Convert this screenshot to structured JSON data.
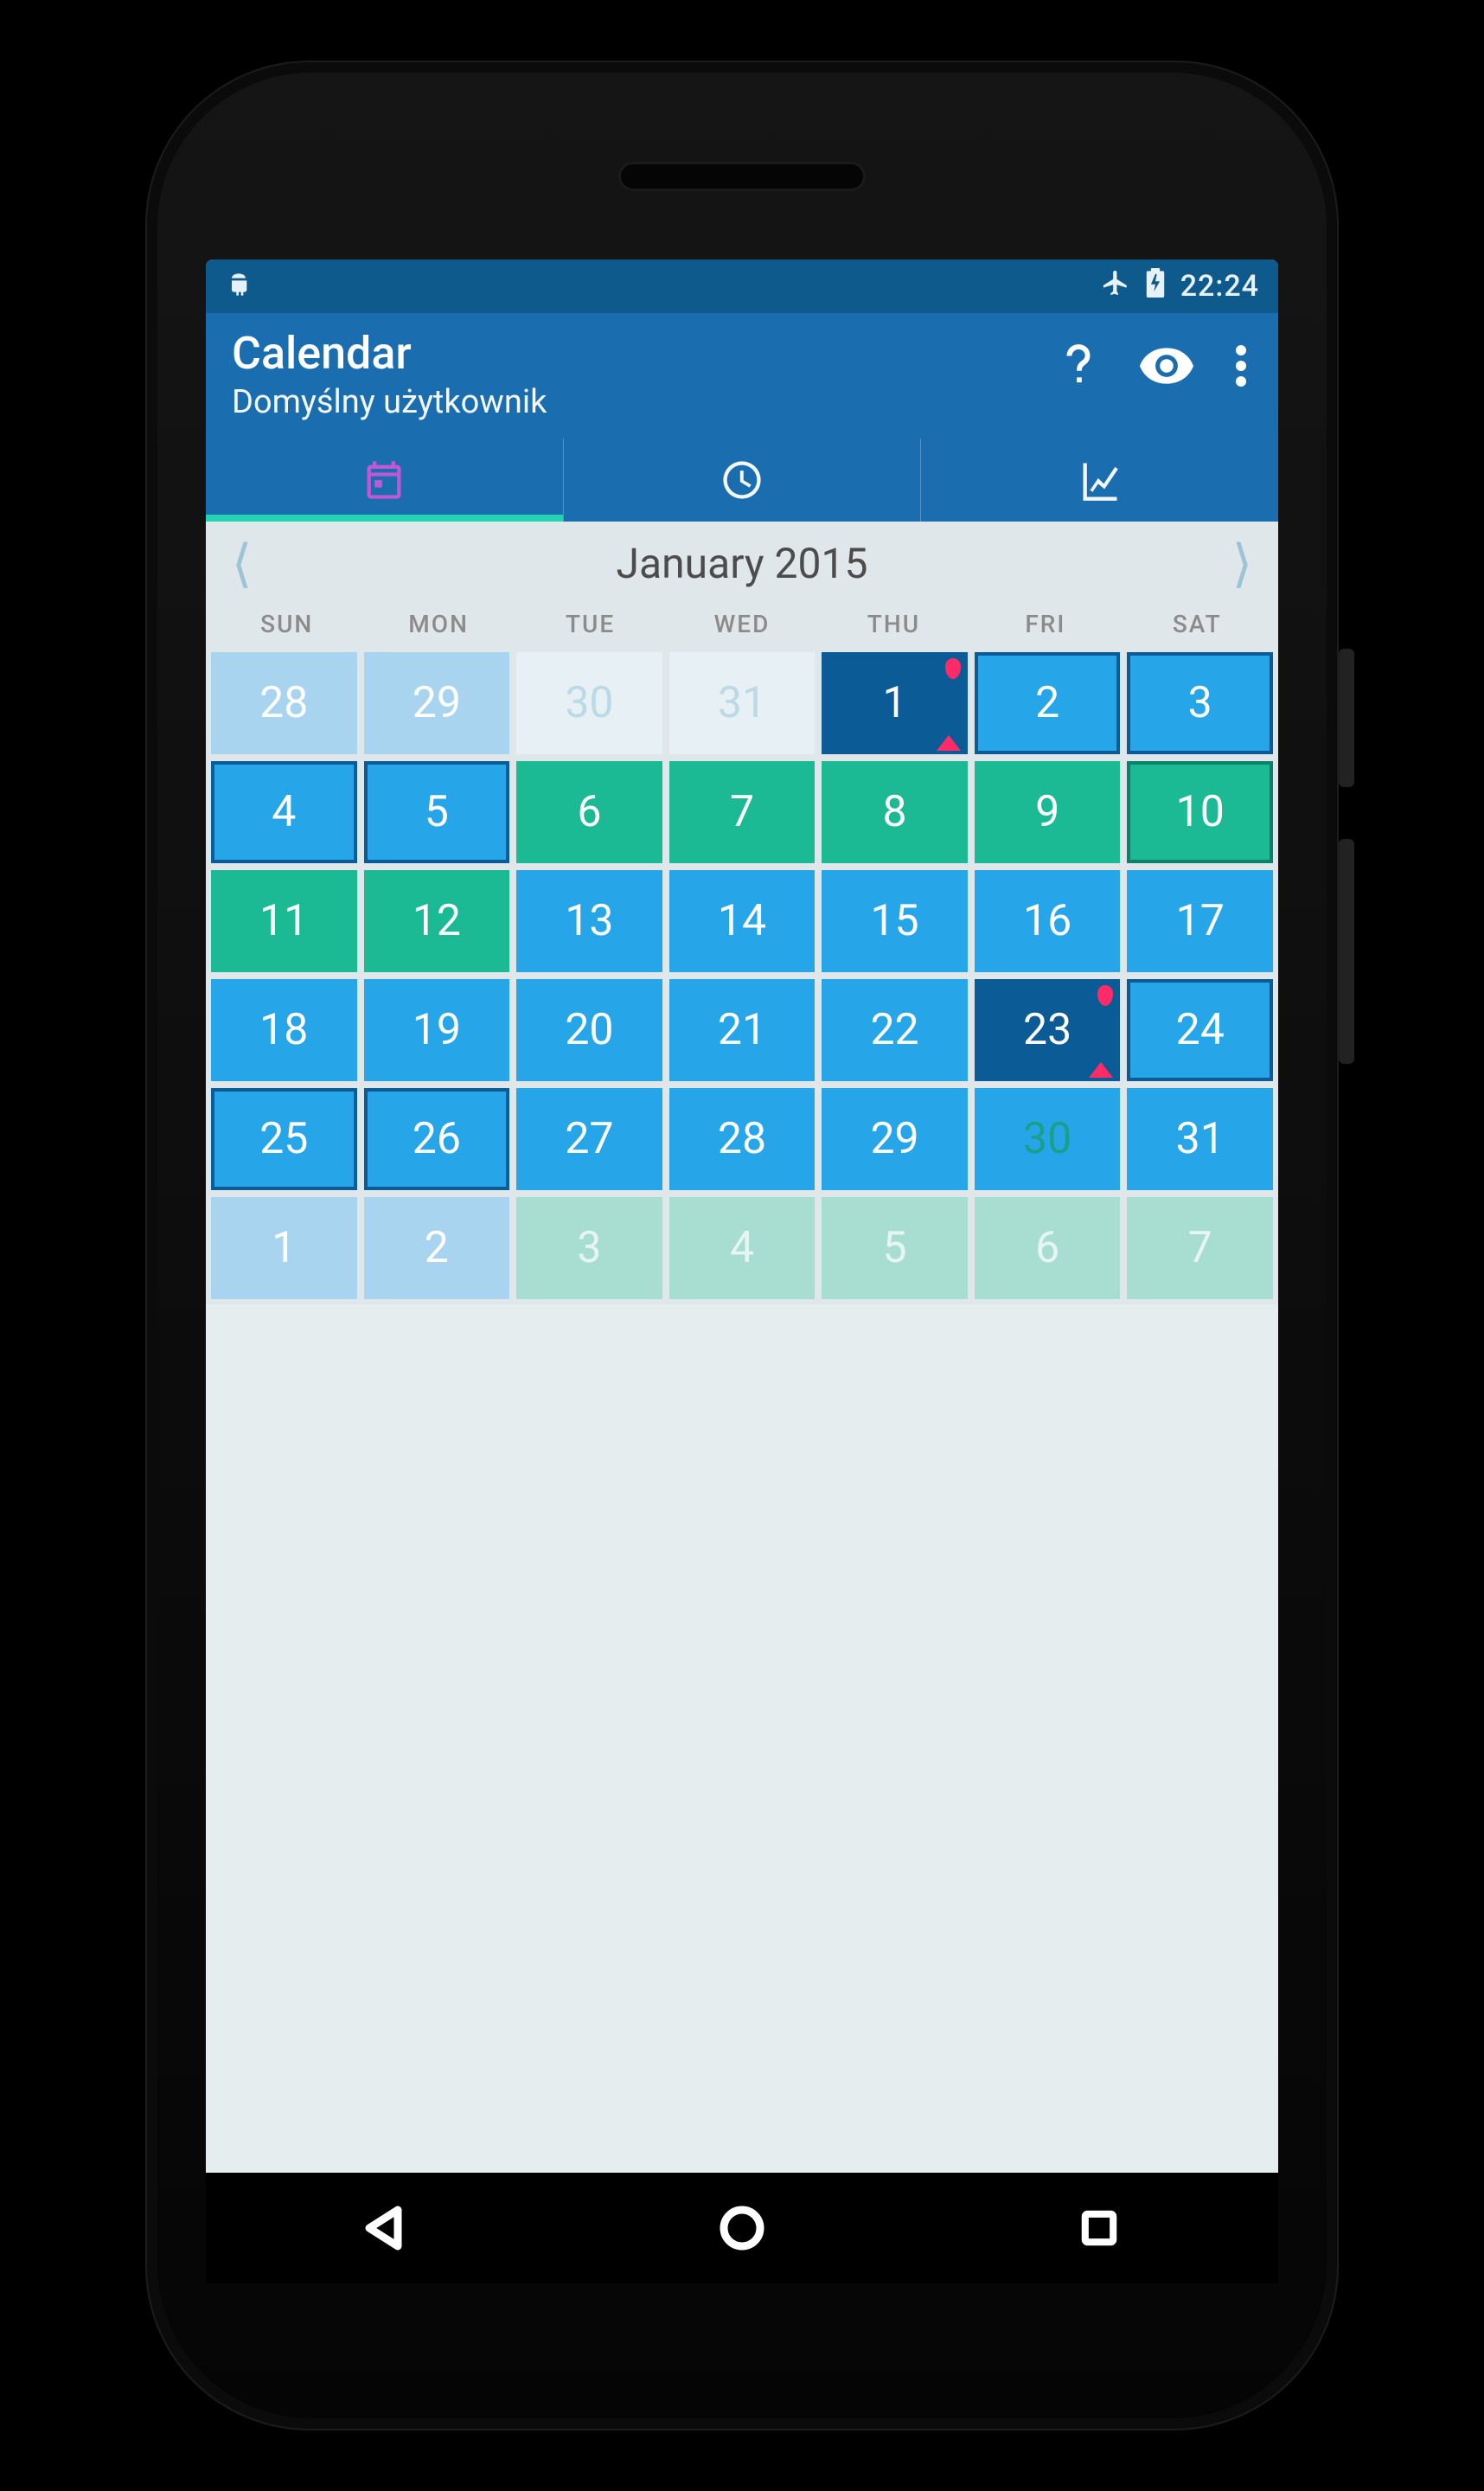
{
  "status": {
    "time": "22:24"
  },
  "appbar": {
    "title": "Calendar",
    "subtitle": "Domyślny użytkownik"
  },
  "month": {
    "label": "January 2015"
  },
  "weekdays": [
    "SUN",
    "MON",
    "TUE",
    "WED",
    "THU",
    "FRI",
    "SAT"
  ],
  "cells": [
    {
      "d": "28",
      "cls": "cell oprev blue",
      "marks": false
    },
    {
      "d": "29",
      "cls": "cell oprev blue",
      "marks": false
    },
    {
      "d": "30",
      "cls": "cell oprev pale",
      "marks": false
    },
    {
      "d": "31",
      "cls": "cell oprev pale",
      "marks": false
    },
    {
      "d": "1",
      "cls": "cell navy",
      "marks": true
    },
    {
      "d": "2",
      "cls": "cell sky bordered",
      "marks": false
    },
    {
      "d": "3",
      "cls": "cell sky bordered",
      "marks": false
    },
    {
      "d": "4",
      "cls": "cell sky bordered",
      "marks": false
    },
    {
      "d": "5",
      "cls": "cell sky bordered",
      "marks": false
    },
    {
      "d": "6",
      "cls": "cell green",
      "marks": false
    },
    {
      "d": "7",
      "cls": "cell green",
      "marks": false
    },
    {
      "d": "8",
      "cls": "cell green",
      "marks": false
    },
    {
      "d": "9",
      "cls": "cell green",
      "marks": false
    },
    {
      "d": "10",
      "cls": "cell green bordered",
      "marks": false
    },
    {
      "d": "11",
      "cls": "cell green",
      "marks": false
    },
    {
      "d": "12",
      "cls": "cell green",
      "marks": false
    },
    {
      "d": "13",
      "cls": "cell sky",
      "marks": false
    },
    {
      "d": "14",
      "cls": "cell sky",
      "marks": false
    },
    {
      "d": "15",
      "cls": "cell sky",
      "marks": false
    },
    {
      "d": "16",
      "cls": "cell sky",
      "marks": false
    },
    {
      "d": "17",
      "cls": "cell sky",
      "marks": false
    },
    {
      "d": "18",
      "cls": "cell sky",
      "marks": false
    },
    {
      "d": "19",
      "cls": "cell sky",
      "marks": false
    },
    {
      "d": "20",
      "cls": "cell sky",
      "marks": false
    },
    {
      "d": "21",
      "cls": "cell sky",
      "marks": false
    },
    {
      "d": "22",
      "cls": "cell sky",
      "marks": false
    },
    {
      "d": "23",
      "cls": "cell navy",
      "marks": true
    },
    {
      "d": "24",
      "cls": "cell sky bordered",
      "marks": false
    },
    {
      "d": "25",
      "cls": "cell sky bordered",
      "marks": false
    },
    {
      "d": "26",
      "cls": "cell sky bordered",
      "marks": false
    },
    {
      "d": "27",
      "cls": "cell sky",
      "marks": false
    },
    {
      "d": "28",
      "cls": "cell sky",
      "marks": false
    },
    {
      "d": "29",
      "cls": "cell sky",
      "marks": false
    },
    {
      "d": "30",
      "cls": "cell fade-green",
      "marks": false
    },
    {
      "d": "31",
      "cls": "cell sky",
      "marks": false
    },
    {
      "d": "1",
      "cls": "cell onext blue",
      "marks": false
    },
    {
      "d": "2",
      "cls": "cell onext blue",
      "marks": false
    },
    {
      "d": "3",
      "cls": "cell onext green",
      "marks": false
    },
    {
      "d": "4",
      "cls": "cell onext green",
      "marks": false
    },
    {
      "d": "5",
      "cls": "cell onext green",
      "marks": false
    },
    {
      "d": "6",
      "cls": "cell onext green",
      "marks": false
    },
    {
      "d": "7",
      "cls": "cell onext mint",
      "marks": false
    }
  ],
  "colors": {
    "primary": "#1a6eb0",
    "primaryDark": "#0f5a8c",
    "accent": "#23d3b3",
    "sky": "#26a6e9",
    "green": "#1cb995",
    "navy": "#0b5c96",
    "marker": "#ff2a68",
    "tabActiveIcon": "#c857d4"
  }
}
